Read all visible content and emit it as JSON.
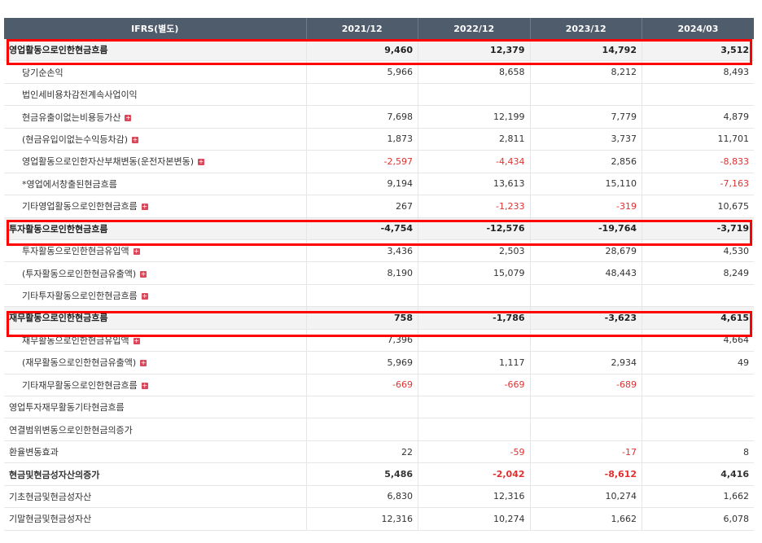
{
  "header": {
    "label": "IFRS(별도)",
    "periods": [
      "2021/12",
      "2022/12",
      "2023/12",
      "2024/03"
    ]
  },
  "rows": [
    {
      "label": "영업활동으로인한현금흐름",
      "type": "major",
      "values": [
        "9,460",
        "12,379",
        "14,792",
        "3,512"
      ]
    },
    {
      "label": "당기순손익",
      "type": "sub",
      "values": [
        "5,966",
        "8,658",
        "8,212",
        "8,493"
      ]
    },
    {
      "label": "법인세비용차감전계속사업이익",
      "type": "sub",
      "values": [
        "",
        "",
        "",
        ""
      ]
    },
    {
      "label": "현금유출이없는비용등가산",
      "type": "sub",
      "expand": true,
      "values": [
        "7,698",
        "12,199",
        "7,779",
        "4,879"
      ]
    },
    {
      "label": "(현금유입이없는수익등차감)",
      "type": "sub",
      "expand": true,
      "values": [
        "1,873",
        "2,811",
        "3,737",
        "11,701"
      ]
    },
    {
      "label": "영업활동으로인한자산부채변동(운전자본변동)",
      "type": "sub",
      "expand": true,
      "values": [
        "-2,597",
        "-4,434",
        "2,856",
        "-8,833"
      ]
    },
    {
      "label": "*영업에서창출된현금흐름",
      "type": "sub",
      "values": [
        "9,194",
        "13,613",
        "15,110",
        "-7,163"
      ]
    },
    {
      "label": "기타영업활동으로인한현금흐름",
      "type": "sub",
      "expand": true,
      "values": [
        "267",
        "-1,233",
        "-319",
        "10,675"
      ]
    },
    {
      "label": "투자활동으로인한현금흐름",
      "type": "major",
      "values": [
        "-4,754",
        "-12,576",
        "-19,764",
        "-3,719"
      ]
    },
    {
      "label": "투자활동으로인한현금유입액",
      "type": "sub",
      "expand": true,
      "values": [
        "3,436",
        "2,503",
        "28,679",
        "4,530"
      ]
    },
    {
      "label": "(투자활동으로인한현금유출액)",
      "type": "sub",
      "expand": true,
      "values": [
        "8,190",
        "15,079",
        "48,443",
        "8,249"
      ]
    },
    {
      "label": "기타투자활동으로인한현금흐름",
      "type": "sub",
      "expand": true,
      "values": [
        "",
        "",
        "",
        ""
      ]
    },
    {
      "label": "재무활동으로인한현금흐름",
      "type": "major",
      "values": [
        "758",
        "-1,786",
        "-3,623",
        "4,615"
      ]
    },
    {
      "label": "재무활동으로인한현금유입액",
      "type": "sub",
      "expand": true,
      "values": [
        "7,396",
        "",
        "",
        "4,664"
      ]
    },
    {
      "label": "(재무활동으로인한현금유출액)",
      "type": "sub",
      "expand": true,
      "values": [
        "5,969",
        "1,117",
        "2,934",
        "49"
      ]
    },
    {
      "label": "기타재무활동으로인한현금흐름",
      "type": "sub",
      "expand": true,
      "values": [
        "-669",
        "-669",
        "-689",
        ""
      ]
    },
    {
      "label": "영업투자재무활동기타현금흐름",
      "type": "plain",
      "values": [
        "",
        "",
        "",
        ""
      ]
    },
    {
      "label": "연결범위변동으로인한현금의증가",
      "type": "plain",
      "values": [
        "",
        "",
        "",
        ""
      ]
    },
    {
      "label": "환율변동효과",
      "type": "plain",
      "values": [
        "22",
        "-59",
        "-17",
        "8"
      ]
    },
    {
      "label": "현금및현금성자산의증가",
      "type": "bold",
      "values": [
        "5,486",
        "-2,042",
        "-8,612",
        "4,416"
      ]
    },
    {
      "label": "기초현금및현금성자산",
      "type": "plain",
      "values": [
        "6,830",
        "12,316",
        "10,274",
        "1,662"
      ]
    },
    {
      "label": "기말현금및현금성자산",
      "type": "plain",
      "values": [
        "12,316",
        "10,274",
        "1,662",
        "6,078"
      ]
    }
  ],
  "highlight_color": "#ff0000",
  "negative_color": "#e03131",
  "expand_icon": "plus-square-icon"
}
